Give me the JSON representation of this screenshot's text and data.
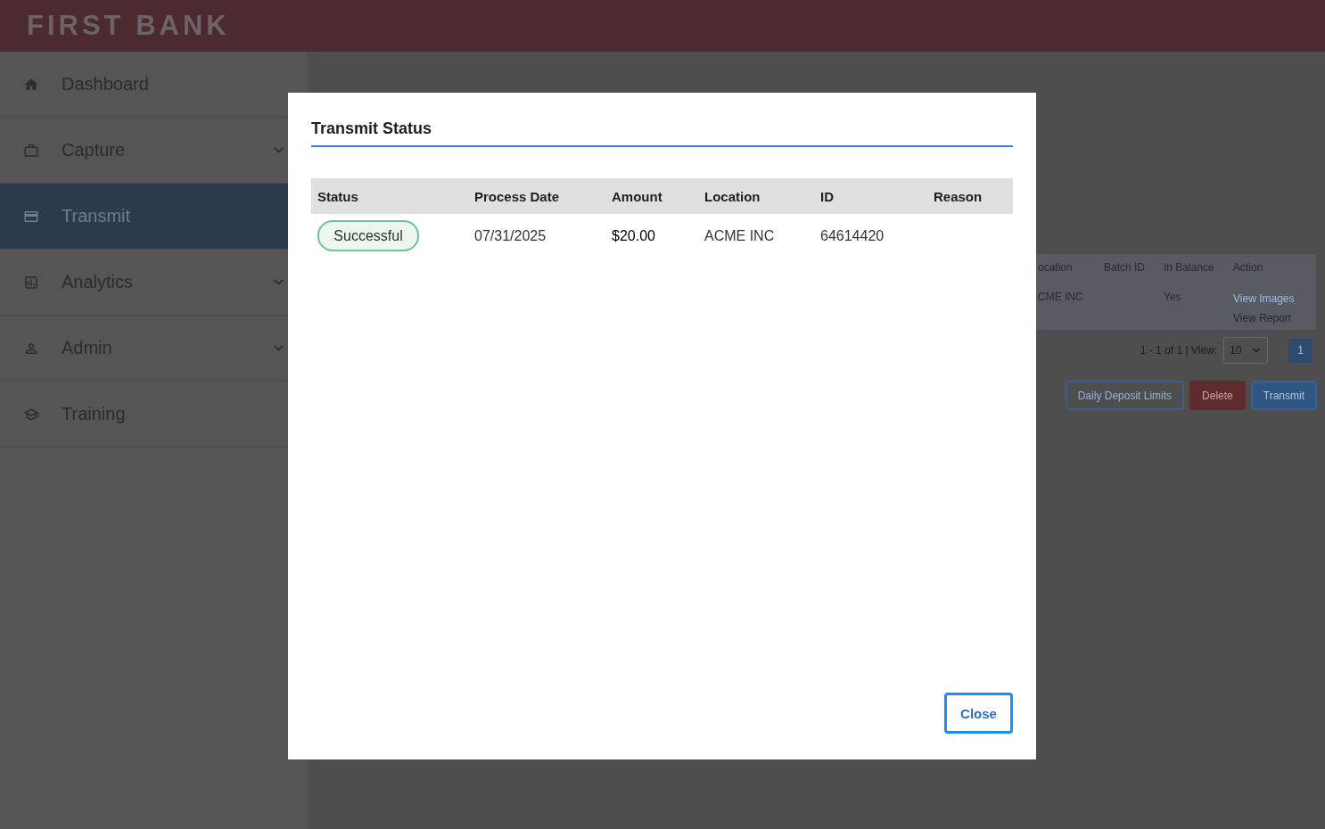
{
  "header": {
    "logo": "FIRST BANK"
  },
  "sidebar": {
    "items": [
      {
        "label": "Dashboard",
        "selected": false,
        "expandable": false
      },
      {
        "label": "Capture",
        "selected": false,
        "expandable": true
      },
      {
        "label": "Transmit",
        "selected": true,
        "expandable": false
      },
      {
        "label": "Analytics",
        "selected": false,
        "expandable": true
      },
      {
        "label": "Admin",
        "selected": false,
        "expandable": true
      },
      {
        "label": "Training",
        "selected": false,
        "expandable": false
      }
    ]
  },
  "background_panel": {
    "table": {
      "columns": [
        "ocation",
        "Batch ID",
        "In Balance",
        "Action"
      ],
      "rows": [
        {
          "cells": [
            "CME INC",
            "",
            "Yes"
          ],
          "actions": [
            {
              "label": "View Images",
              "disabled": false
            },
            {
              "label": "View Report",
              "disabled": true
            }
          ]
        }
      ]
    },
    "pagination": {
      "summary": "1 - 1 of 1 | View:",
      "page_size": "10",
      "pages": [
        {
          "label": "1",
          "selected": true
        }
      ]
    },
    "buttons": [
      {
        "label": "Daily Deposit Limits",
        "kind": "outline"
      },
      {
        "label": "Delete",
        "kind": "danger"
      },
      {
        "label": "Transmit",
        "kind": "primary"
      }
    ]
  },
  "modal": {
    "title": "Transmit Status",
    "table": {
      "columns": [
        "Status",
        "Process Date",
        "Amount",
        "Location",
        "ID",
        "Reason"
      ],
      "rows": [
        {
          "cells": [
            {
              "kind": "badge",
              "text": "Successful"
            },
            {
              "kind": "text",
              "text": "07/31/2025"
            },
            {
              "kind": "amount",
              "text": "$20.00"
            },
            {
              "kind": "text",
              "text": "ACME INC"
            },
            {
              "kind": "text",
              "text": "64614420"
            }
          ]
        }
      ]
    },
    "buttons": [
      {
        "label": "Close"
      }
    ]
  }
}
